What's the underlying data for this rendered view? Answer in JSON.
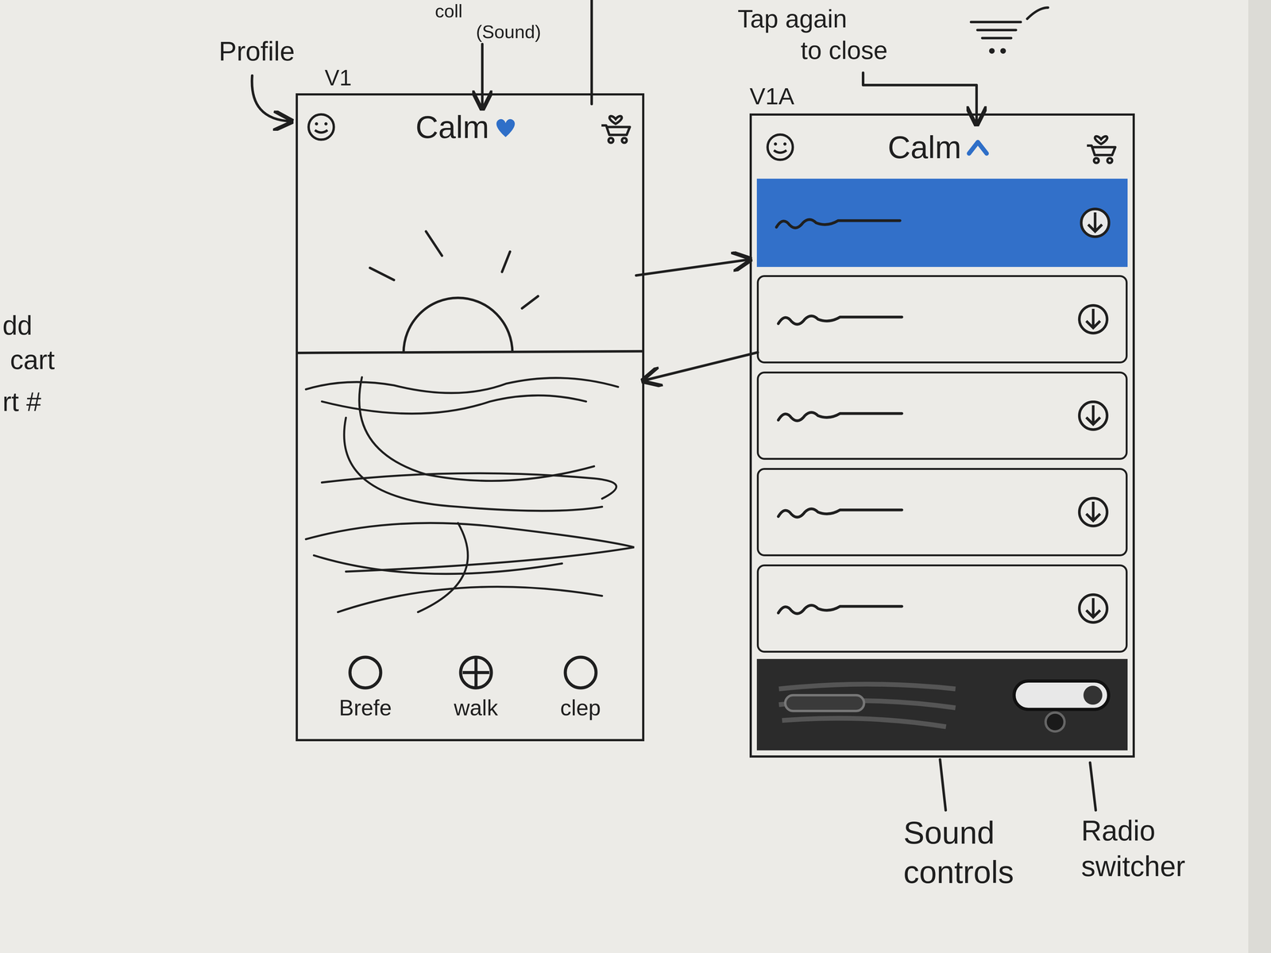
{
  "notes": {
    "profile": "Profile",
    "top_cut": [
      "coll",
      "(Sound)"
    ],
    "tap_close": [
      "Tap again",
      "to close"
    ],
    "left_cut": [
      "dd",
      "cart",
      "rt #"
    ],
    "sound_controls": [
      "Sound",
      "controls"
    ],
    "radio_switcher": [
      "Radio",
      "switcher"
    ]
  },
  "screens": [
    {
      "kind": "home",
      "version": "V1",
      "title": "Calm",
      "expanded": false,
      "nav": [
        {
          "label": "Brefe"
        },
        {
          "label": "walk"
        },
        {
          "label": "clep"
        }
      ]
    },
    {
      "kind": "list",
      "version": "V1A",
      "title": "Calm",
      "expanded": true,
      "rows": [
        {
          "selected": true
        },
        {
          "selected": false
        },
        {
          "selected": false
        },
        {
          "selected": false
        },
        {
          "selected": false
        }
      ]
    }
  ]
}
